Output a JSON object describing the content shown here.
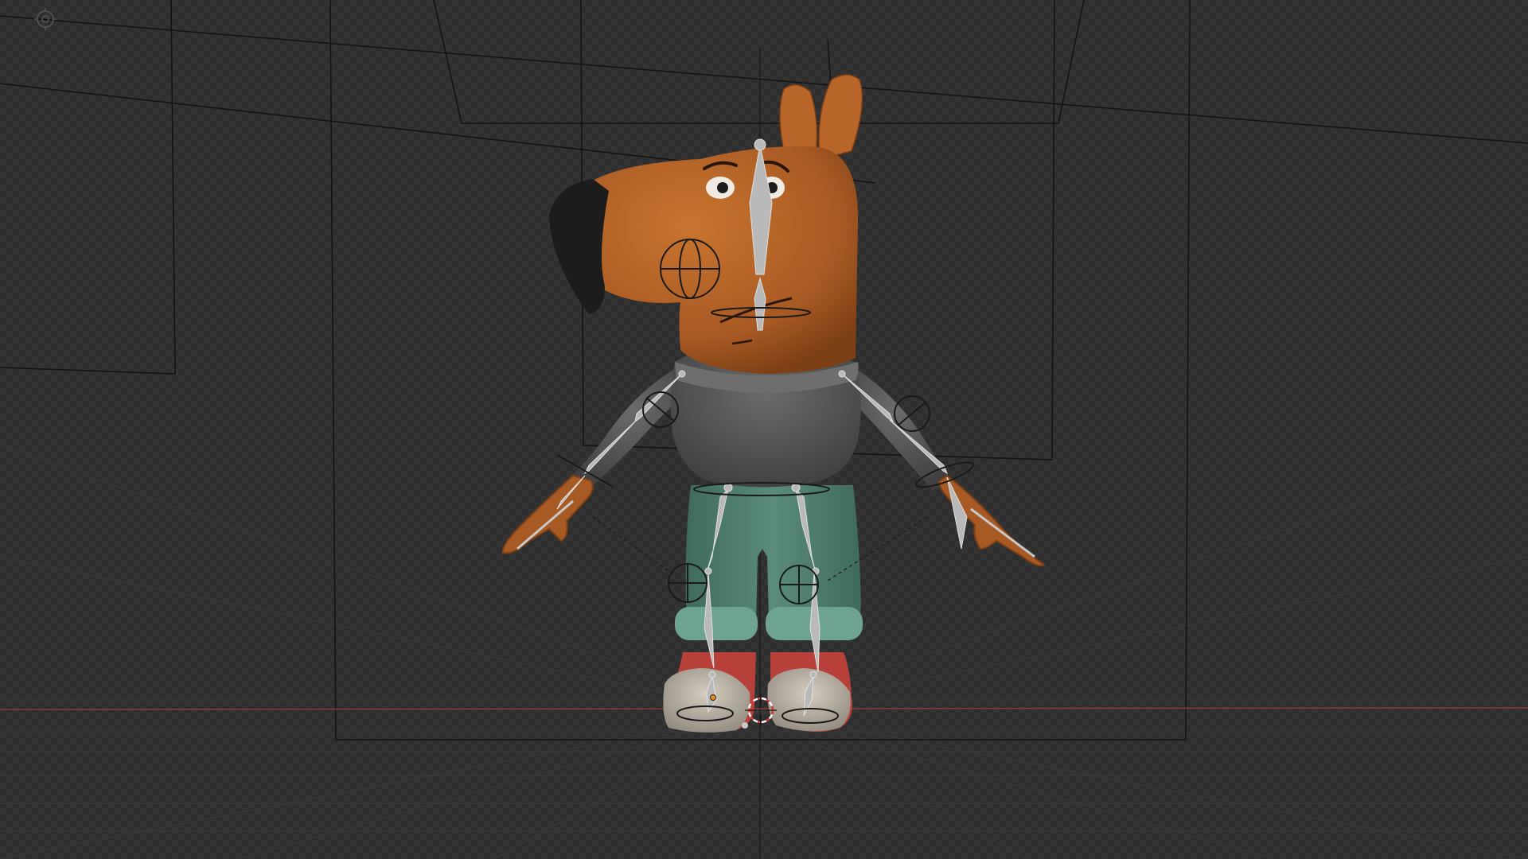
{
  "viewport": {
    "mode": "pose-mode",
    "shading": "material-preview",
    "background": "checker-transparent"
  },
  "icons": {
    "gizmo": "camera-origin-icon",
    "origin": "object-origin-icon",
    "cursor": "3d-cursor-icon"
  },
  "colors": {
    "skin": "#b8652a",
    "skin_dark": "#8a4518",
    "nose": "#1c1c1c",
    "sweater": "#5d5d5d",
    "sweater_dark": "#474747",
    "pants": "#4f7d6e",
    "pants_cuff": "#6ea392",
    "shoe": "#bfb6a8",
    "shoe_accent": "#b8403a",
    "bone": "#b9b9b9",
    "floor_line": "#8a3a3a",
    "cursor": "#d63a3a"
  }
}
